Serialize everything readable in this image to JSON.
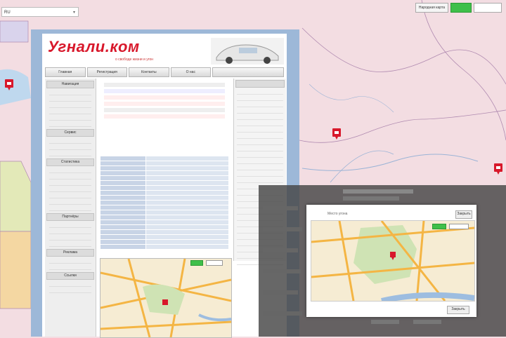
{
  "search": {
    "value": "RU"
  },
  "map_controls": {
    "labels": [
      "Народная карта",
      "",
      ""
    ]
  },
  "site": {
    "logo": "Угнали.ком",
    "tagline": "о свободе жизни и угон",
    "nav": [
      "Главная",
      "Регистрация",
      "Контакты",
      "О нас"
    ],
    "left_sections": [
      "Навигация",
      "Сервис",
      "Статистика",
      "Партнёры",
      "Реклама",
      "Ссылки"
    ]
  },
  "modal": {
    "title": "Место угона",
    "close_label": "Закрыть",
    "ok_label": "Закрыть"
  },
  "colors": {
    "brand": "#d8182b",
    "map_road": "#f4b544",
    "map_bg": "#f3dde2",
    "accent_green": "#3fbf4a"
  }
}
